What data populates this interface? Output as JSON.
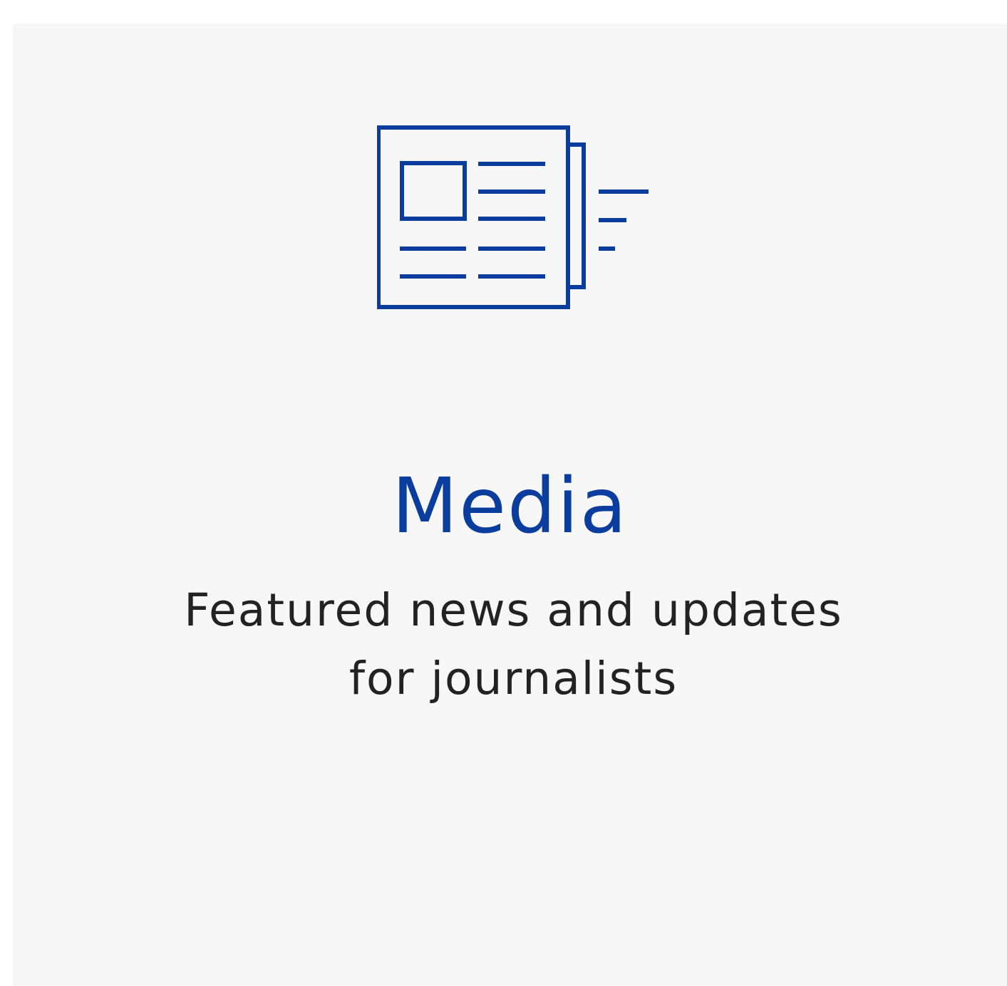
{
  "card": {
    "title": "Media",
    "description": "Featured news and updates for journalists",
    "icon": "newspaper-icon"
  },
  "colors": {
    "accent": "#0a3d9e",
    "card_background": "#f7f7f7",
    "text": "#222222",
    "page_background": "#ffffff"
  }
}
